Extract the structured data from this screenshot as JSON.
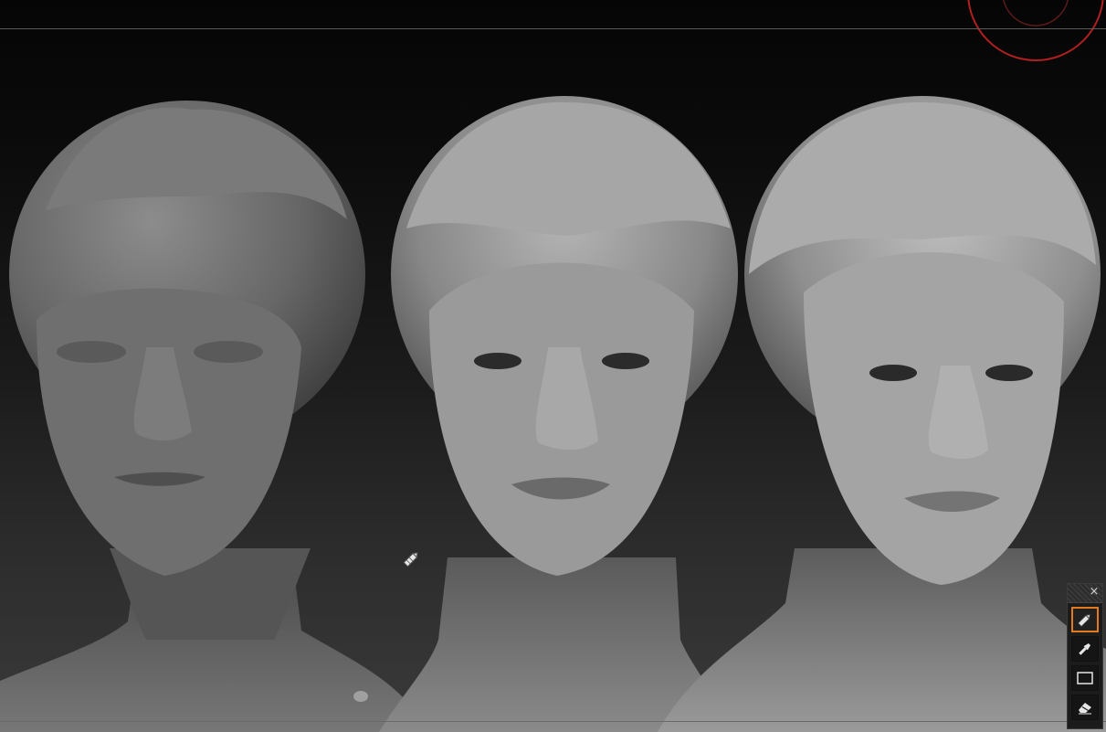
{
  "viewport": {
    "subject": "three-sculpted-head-busts",
    "background_top": "#050505",
    "background_bottom": "#3a3a3a",
    "clay_color": "#9a9a9a"
  },
  "palette": {
    "close_glyph": "×",
    "tools": [
      {
        "id": "draw",
        "icon": "pencil-icon",
        "active": true
      },
      {
        "id": "brush",
        "icon": "brush-icon",
        "active": false
      },
      {
        "id": "rect",
        "icon": "rectangle-icon",
        "active": false
      },
      {
        "id": "erase",
        "icon": "eraser-icon",
        "active": false
      }
    ],
    "accent": "#e07b22"
  },
  "overlay": {
    "circle_color": "#b02020",
    "cursor": "pencil-cursor-icon"
  }
}
